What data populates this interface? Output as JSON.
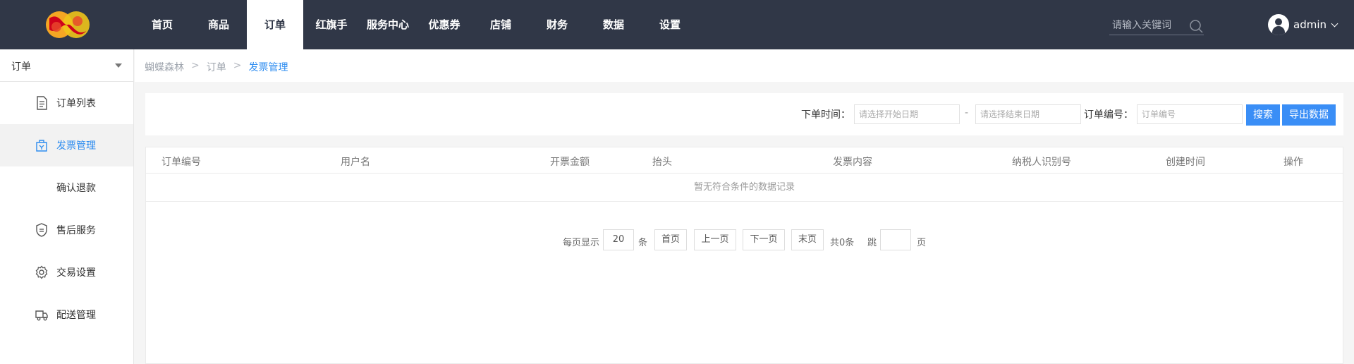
{
  "nav": {
    "items": [
      "首页",
      "商品",
      "订单",
      "红旗手",
      "服务中心",
      "优惠券",
      "店铺",
      "财务",
      "数据",
      "设置"
    ],
    "active_index": 2
  },
  "search": {
    "placeholder": "请输入关键词"
  },
  "user": {
    "name": "admin"
  },
  "sidebar": {
    "header": "订单",
    "items": [
      {
        "label": "订单列表",
        "icon": "document-icon"
      },
      {
        "label": "发票管理",
        "icon": "invoice-icon",
        "active": true
      },
      {
        "label": "确认退款",
        "icon": ""
      },
      {
        "label": "售后服务",
        "icon": "shield-icon"
      },
      {
        "label": "交易设置",
        "icon": "gear-icon"
      },
      {
        "label": "配送管理",
        "icon": "delivery-icon"
      }
    ]
  },
  "breadcrumb": {
    "items": [
      "蝴蝶森林",
      "订单",
      "发票管理"
    ],
    "separator": ">"
  },
  "filter": {
    "order_time_label": "下单时间：",
    "start_placeholder": "请选择开始日期",
    "dash": "-",
    "end_placeholder": "请选择结束日期",
    "order_no_label": "订单编号：",
    "order_no_placeholder": "订单编号",
    "search_button": "搜索",
    "export_button": "导出数据"
  },
  "table": {
    "columns": [
      "订单编号",
      "用户名",
      "开票金额",
      "抬头",
      "发票内容",
      "纳税人识别号",
      "创建时间",
      "操作"
    ],
    "empty_text": "暂无符合条件的数据记录"
  },
  "pager": {
    "per_page_label": "每页显示",
    "per_page_value": "20",
    "unit": "条",
    "first": "首页",
    "prev": "上一页",
    "next": "下一页",
    "last": "末页",
    "total": "共0条",
    "jump_label": "跳",
    "jump_value": "",
    "page_unit": "页"
  },
  "colors": {
    "topbar": "#303747",
    "accent": "#2d8cf0",
    "button": "#3a8ef6"
  }
}
